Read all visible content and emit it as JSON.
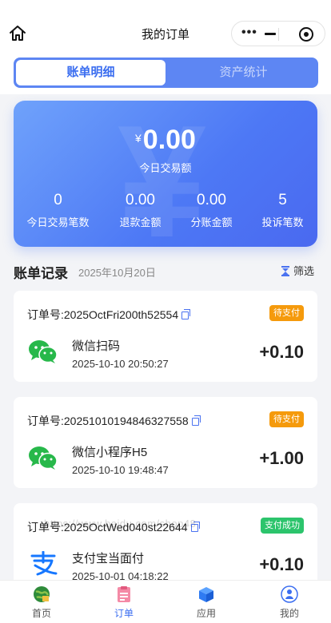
{
  "header": {
    "title": "我的订单"
  },
  "tabs": [
    {
      "label": "账单明细",
      "active": true
    },
    {
      "label": "资产统计",
      "active": false
    }
  ],
  "summary": {
    "currency_symbol": "¥",
    "amount": "0.00",
    "amount_label": "今日交易额",
    "watermark": "¥",
    "stats": [
      {
        "value": "0",
        "label": "今日交易笔数"
      },
      {
        "value": "0.00",
        "label": "退款金额"
      },
      {
        "value": "0.00",
        "label": "分账金额"
      },
      {
        "value": "5",
        "label": "投诉笔数"
      }
    ]
  },
  "records": {
    "title": "账单记录",
    "date": "2025年10月20日",
    "filter_label": "筛选"
  },
  "orders": [
    {
      "no_prefix": "订单号:",
      "no": "2025OctFri200th52554",
      "status": "待支付",
      "status_color": "#f59a0c",
      "method": "微信扫码",
      "time": "2025-10-10 20:50:27",
      "amount": "+0.10",
      "icon": "wechat-icon"
    },
    {
      "no_prefix": "订单号:",
      "no": "20251010194846327558",
      "status": "待支付",
      "status_color": "#f59a0c",
      "method": "微信小程序H5",
      "time": "2025-10-10 19:48:47",
      "amount": "+1.00",
      "icon": "wechat-icon"
    },
    {
      "no_prefix": "订单号:",
      "no": "2025OctWed040st22644",
      "status": "支付成功",
      "status_color": "#2cc46c",
      "method": "支付宝当面付",
      "time": "2025-10-01 04:18:22",
      "amount": "+0.10",
      "icon": "alipay-icon"
    }
  ],
  "overlay_url": "https://www.baidu.com/shop48",
  "tabbar": [
    {
      "label": "首页",
      "icon": "home-globe-icon",
      "active": false
    },
    {
      "label": "订单",
      "icon": "order-icon",
      "active": true
    },
    {
      "label": "应用",
      "icon": "apps-cube-icon",
      "active": false
    },
    {
      "label": "我的",
      "icon": "profile-icon",
      "active": false
    }
  ],
  "colors": {
    "accent": "#3b6ef0",
    "pending": "#f59a0c",
    "success": "#2cc46c"
  }
}
